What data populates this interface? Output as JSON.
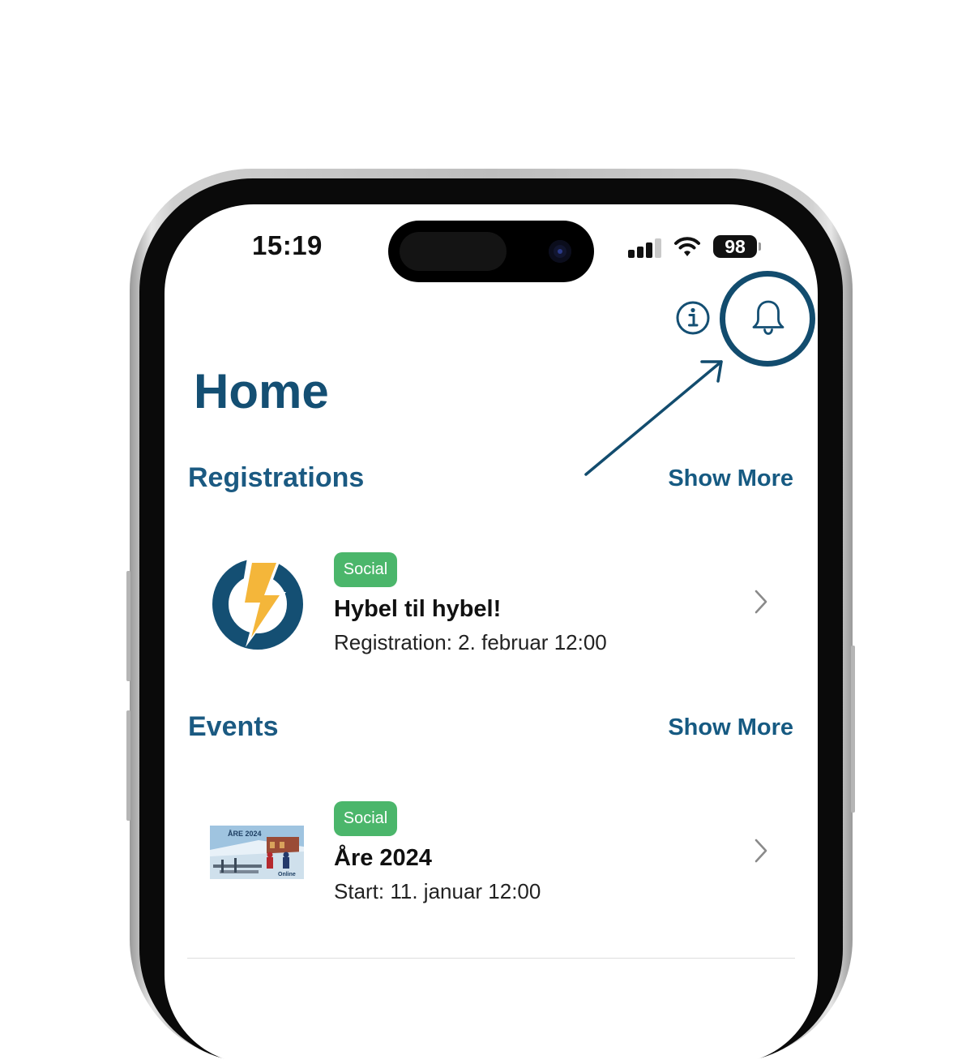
{
  "status_bar": {
    "time": "15:19",
    "battery": "98"
  },
  "header": {
    "title": "Home",
    "info_icon": "info-icon",
    "bell_icon": "bell-icon"
  },
  "registrations": {
    "section_title": "Registrations",
    "show_more": "Show More",
    "items": [
      {
        "badge": "Social",
        "title": "Hybel til hybel!",
        "subtitle": "Registration: 2. februar 12:00",
        "thumb_icon": "lightning-power-logo-icon"
      }
    ]
  },
  "events": {
    "section_title": "Events",
    "show_more": "Show More",
    "items": [
      {
        "badge": "Social",
        "title": "Åre 2024",
        "subtitle": "Start: 11. januar 12:00",
        "thumb_title": "ÅRE 2024",
        "thumb_tag": "Online"
      }
    ]
  },
  "colors": {
    "primary": "#144f73",
    "badge_green": "#4bb66b",
    "logo_orange": "#f4b63a",
    "annotation": "#124c6e"
  }
}
